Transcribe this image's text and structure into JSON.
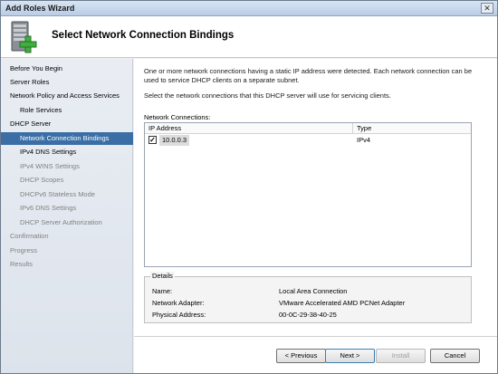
{
  "window": {
    "title": "Add Roles Wizard",
    "close_glyph": "✕"
  },
  "header": {
    "title": "Select Network Connection Bindings",
    "icon": "server-add-icon"
  },
  "sidebar": {
    "items": [
      {
        "label": "Before You Begin",
        "state": "done"
      },
      {
        "label": "Server Roles",
        "state": "done"
      },
      {
        "label": "Network Policy and Access Services",
        "state": "done"
      },
      {
        "label": "Role Services",
        "state": "done"
      },
      {
        "label": "DHCP Server",
        "state": "done"
      },
      {
        "label": "Network Connection Bindings",
        "state": "current"
      },
      {
        "label": "IPv4 DNS Settings",
        "state": "done"
      },
      {
        "label": "IPv4 WINS Settings",
        "state": "pending"
      },
      {
        "label": "DHCP Scopes",
        "state": "pending"
      },
      {
        "label": "DHCPv6 Stateless Mode",
        "state": "pending"
      },
      {
        "label": "IPv6 DNS Settings",
        "state": "pending"
      },
      {
        "label": "DHCP Server Authorization",
        "state": "pending"
      },
      {
        "label": "Confirmation",
        "state": "pending"
      },
      {
        "label": "Progress",
        "state": "pending"
      },
      {
        "label": "Results",
        "state": "pending"
      }
    ]
  },
  "main": {
    "intro": "One or more network connections having a static IP address were detected. Each network connection can be used to service DHCP clients on a separate subnet.",
    "instruction": "Select the network connections that this DHCP server will use for servicing clients.",
    "connections_label": "Network Connections:",
    "columns": [
      "IP Address",
      "Type"
    ],
    "rows": [
      {
        "checked": true,
        "ip": "10.0.0.3",
        "type": "IPv4"
      }
    ],
    "details": {
      "title": "Details",
      "fields": [
        {
          "key": "Name:",
          "value": "Local Area Connection"
        },
        {
          "key": "Network Adapter:",
          "value": "VMware Accelerated AMD PCNet Adapter"
        },
        {
          "key": "Physical Address:",
          "value": "00-0C-29-38-40-25"
        }
      ]
    }
  },
  "footer": {
    "previous": "< Previous",
    "next": "Next >",
    "install": "Install",
    "cancel": "Cancel"
  },
  "colors": {
    "selection": "#3a6ea5",
    "pending_text": "#808080"
  }
}
